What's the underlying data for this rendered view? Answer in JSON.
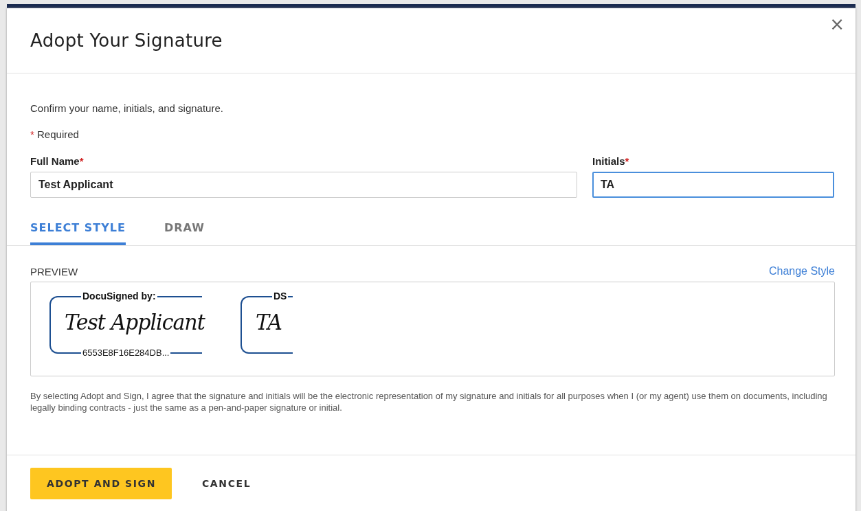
{
  "dialog": {
    "title": "Adopt Your Signature",
    "close": "×"
  },
  "intro": "Confirm your name, initials, and signature.",
  "required_note": {
    "mark": "*",
    "text": "Required"
  },
  "fields": [
    {
      "label": "Full Name",
      "required": true,
      "value": "Test Applicant",
      "focused": false
    },
    {
      "label": "Initials",
      "required": true,
      "value": "TA",
      "focused": true
    }
  ],
  "tabs": [
    {
      "label": "SELECT STYLE",
      "selected": true
    },
    {
      "label": "DRAW",
      "selected": false
    }
  ],
  "preview": {
    "label": "PREVIEW",
    "link": "Change Style",
    "stamps": [
      {
        "kind": "signature",
        "header": "DocuSigned by:",
        "script": "Test Applicant",
        "footer": "6553E8F16E284DB..."
      },
      {
        "kind": "initials",
        "header": "DS",
        "script": "TA"
      }
    ]
  },
  "disclaimer": "By selecting Adopt and Sign, I agree that the signature and initials will be the electronic representation of my signature and initials for all purposes when I (or my agent) use them on documents, including legally binding contracts - just the same as a pen-and-paper signature or initial.",
  "buttons": [
    {
      "kind": "primary",
      "label": "ADOPT AND SIGN"
    },
    {
      "kind": "secondary",
      "label": "CANCEL"
    }
  ]
}
